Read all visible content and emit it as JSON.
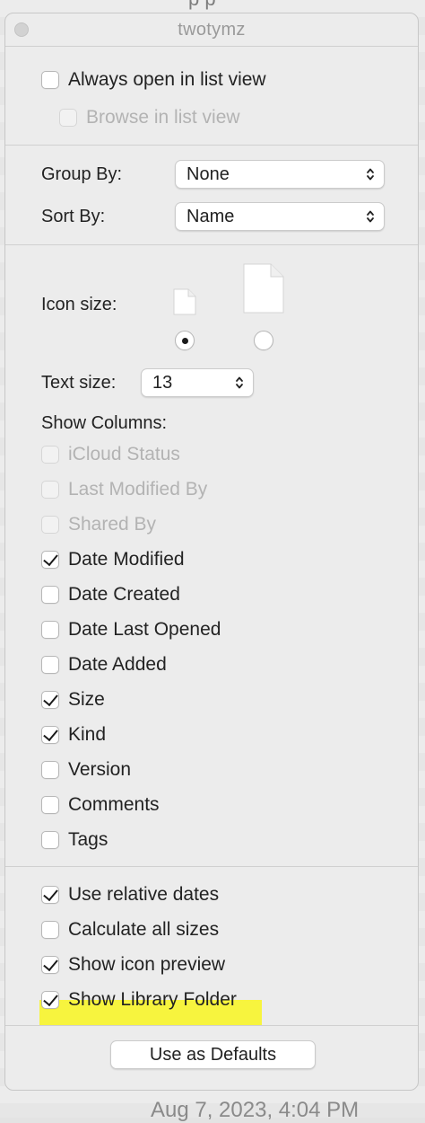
{
  "window": {
    "title": "twotymz"
  },
  "background": {
    "partial_title": "p p",
    "bottom_timestamp": "Aug 7, 2023, 4:04 PM"
  },
  "options": {
    "always_open_list": {
      "label": "Always open in list view",
      "checked": false
    },
    "browse_list": {
      "label": "Browse in list view",
      "checked": false,
      "disabled": true
    }
  },
  "group_by": {
    "label": "Group By:",
    "value": "None"
  },
  "sort_by": {
    "label": "Sort By:",
    "value": "Name"
  },
  "icon_size": {
    "label": "Icon size:",
    "selected": "small"
  },
  "text_size": {
    "label": "Text size:",
    "value": "13"
  },
  "columns": {
    "label": "Show Columns:",
    "items": [
      {
        "label": "iCloud Status",
        "checked": false,
        "disabled": true
      },
      {
        "label": "Last Modified By",
        "checked": false,
        "disabled": true
      },
      {
        "label": "Shared By",
        "checked": false,
        "disabled": true
      },
      {
        "label": "Date Modified",
        "checked": true,
        "disabled": false
      },
      {
        "label": "Date Created",
        "checked": false,
        "disabled": false
      },
      {
        "label": "Date Last Opened",
        "checked": false,
        "disabled": false
      },
      {
        "label": "Date Added",
        "checked": false,
        "disabled": false
      },
      {
        "label": "Size",
        "checked": true,
        "disabled": false
      },
      {
        "label": "Kind",
        "checked": true,
        "disabled": false
      },
      {
        "label": "Version",
        "checked": false,
        "disabled": false
      },
      {
        "label": "Comments",
        "checked": false,
        "disabled": false
      },
      {
        "label": "Tags",
        "checked": false,
        "disabled": false
      }
    ]
  },
  "bottom_options": [
    {
      "label": "Use relative dates",
      "checked": true
    },
    {
      "label": "Calculate all sizes",
      "checked": false
    },
    {
      "label": "Show icon preview",
      "checked": true
    },
    {
      "label": "Show Library Folder",
      "checked": true,
      "highlighted": true
    }
  ],
  "defaults_button": {
    "label": "Use as Defaults"
  },
  "colors": {
    "highlight": "#f8f52b",
    "panel": "#ececec"
  }
}
